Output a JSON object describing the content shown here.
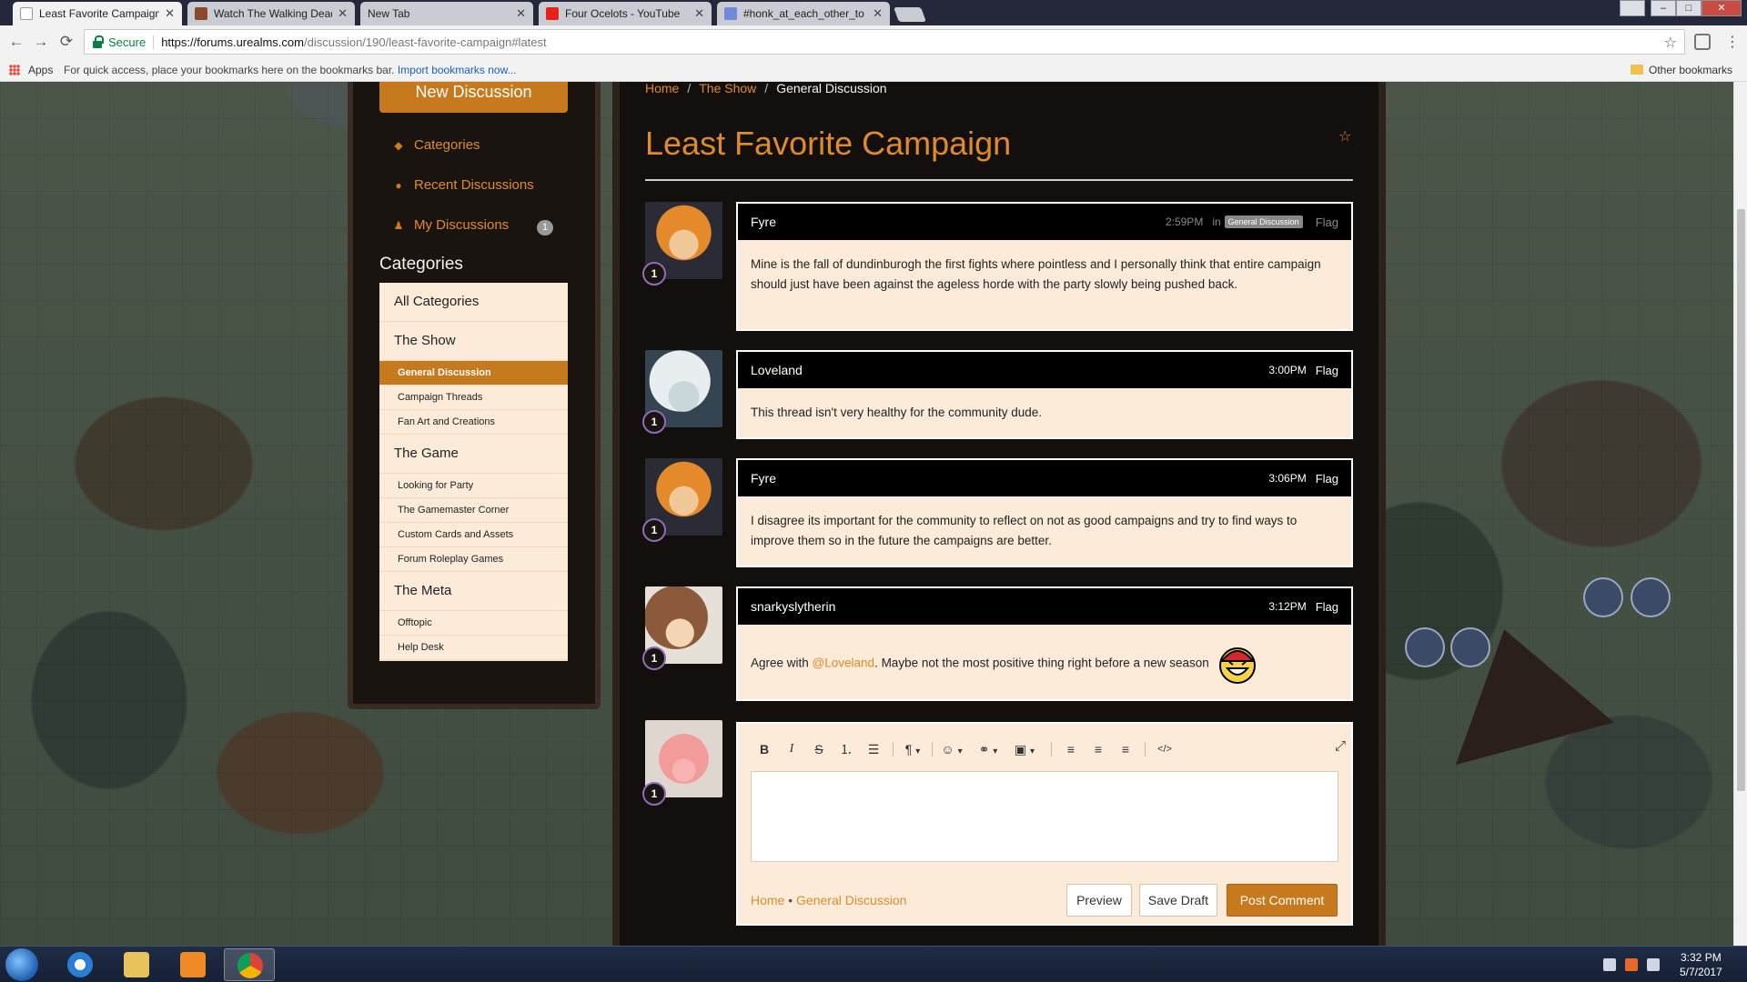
{
  "browser": {
    "tabs": [
      {
        "title": "Least Favorite Campaign",
        "active": true,
        "icon": "page-icon"
      },
      {
        "title": "Watch The Walking Dead",
        "active": false,
        "icon": "film-icon"
      },
      {
        "title": "New Tab",
        "active": false,
        "icon": ""
      },
      {
        "title": "Four Ocelots - YouTube",
        "active": false,
        "icon": "youtube-icon"
      },
      {
        "title": "#honk_at_each_other_to",
        "active": false,
        "icon": "discord-icon"
      }
    ],
    "close_glyph": "✕",
    "window_controls": {
      "minimize": "–",
      "maximize": "□",
      "close": "✕"
    },
    "nav": {
      "back": "←",
      "forward": "→",
      "reload": "⟳"
    },
    "secure_label": "Secure",
    "url_host": "https://forums.urealms.com",
    "url_path": "/discussion/190/least-favorite-campaign#latest",
    "bookmark_star": "☆",
    "menu_glyph": "⋮",
    "bookmarks_bar": {
      "apps_label": "Apps",
      "hint": "For quick access, place your bookmarks here on the bookmarks bar.",
      "import_link": "Import bookmarks now...",
      "other_bookmarks": "Other bookmarks"
    }
  },
  "sidebar": {
    "new_discussion": "New Discussion",
    "links": [
      {
        "label": "Categories",
        "icon": "tag-icon",
        "glyph": "◆"
      },
      {
        "label": "Recent Discussions",
        "icon": "chat-icon",
        "glyph": "●"
      },
      {
        "label": "My Discussions",
        "icon": "user-icon",
        "glyph": "♟"
      }
    ],
    "my_discussions_count": "1",
    "categories_heading": "Categories",
    "categories": [
      {
        "label": "All Categories",
        "level": "top",
        "active": false
      },
      {
        "label": "The Show",
        "level": "top",
        "active": false
      },
      {
        "label": "General Discussion",
        "level": "sub",
        "active": true
      },
      {
        "label": "Campaign Threads",
        "level": "sub",
        "active": false
      },
      {
        "label": "Fan Art and Creations",
        "level": "sub",
        "active": false
      },
      {
        "label": "The Game",
        "level": "top",
        "active": false
      },
      {
        "label": "Looking for Party",
        "level": "sub",
        "active": false
      },
      {
        "label": "The Gamemaster Corner",
        "level": "sub",
        "active": false
      },
      {
        "label": "Custom Cards and Assets",
        "level": "sub",
        "active": false
      },
      {
        "label": "Forum Roleplay Games",
        "level": "sub",
        "active": false
      },
      {
        "label": "The Meta",
        "level": "top",
        "active": false
      },
      {
        "label": "Offtopic",
        "level": "sub",
        "active": false
      },
      {
        "label": "Help Desk",
        "level": "sub",
        "active": false
      }
    ]
  },
  "main": {
    "breadcrumb": {
      "home": "Home",
      "section": "The Show",
      "current": "General Discussion",
      "separator": "/"
    },
    "title": "Least Favorite Campaign",
    "bookmark_glyph": "☆",
    "comments": [
      {
        "author": "Fyre",
        "time": "2:59PM",
        "in_label": "in",
        "category_badge": "General Discussion",
        "flag": "Flag",
        "rank": "1",
        "avatar": "fyre-avatar",
        "body": "Mine is the fall of dundinburogh the first fights where pointless and I personally think that entire campaign should just have been against the ageless horde with the party slowly being pushed back."
      },
      {
        "author": "Loveland",
        "time": "3:00PM",
        "flag": "Flag",
        "rank": "1",
        "avatar": "loveland-avatar",
        "body": "This thread isn't very healthy for the community dude."
      },
      {
        "author": "Fyre",
        "time": "3:06PM",
        "flag": "Flag",
        "rank": "1",
        "avatar": "fyre-avatar",
        "body": "I disagree its important for the community to reflect on not as good campaigns and try to find ways to improve them so in the future the campaigns are better."
      },
      {
        "author": "snarkyslytherin",
        "time": "3:12PM",
        "flag": "Flag",
        "rank": "1",
        "avatar": "snarky-avatar",
        "body_pre": "Agree with ",
        "mention": "@Loveland",
        "body_post": ". Maybe not the most positive thing right before a new season",
        "emoji": "grinning-emoji"
      }
    ],
    "editor": {
      "rank": "1",
      "avatar": "pig-avatar",
      "toolbar": {
        "bold": "B",
        "italic": "I",
        "strike": "S",
        "ordered_list": "⒈",
        "bullet_list": "☰",
        "paragraph": "¶",
        "emoji": "☺",
        "link": "⚭",
        "image": "▣",
        "align_left": "≡",
        "align_center": "≡",
        "align_right": "≡",
        "code": "</>",
        "dropdown": "▾",
        "fullscreen": "⤢"
      },
      "links_home": "Home",
      "links_sep": "•",
      "links_category": "General Discussion",
      "preview": "Preview",
      "save_draft": "Save Draft",
      "post_comment": "Post Comment"
    }
  },
  "taskbar": {
    "apps": [
      "internet-explorer-icon",
      "file-explorer-icon",
      "media-player-icon",
      "chrome-icon"
    ],
    "time": "3:32 PM",
    "date": "5/7/2017"
  },
  "colors": {
    "accent": "#e08b2a",
    "button": "#c7791e",
    "panel": "#fcebd9"
  }
}
